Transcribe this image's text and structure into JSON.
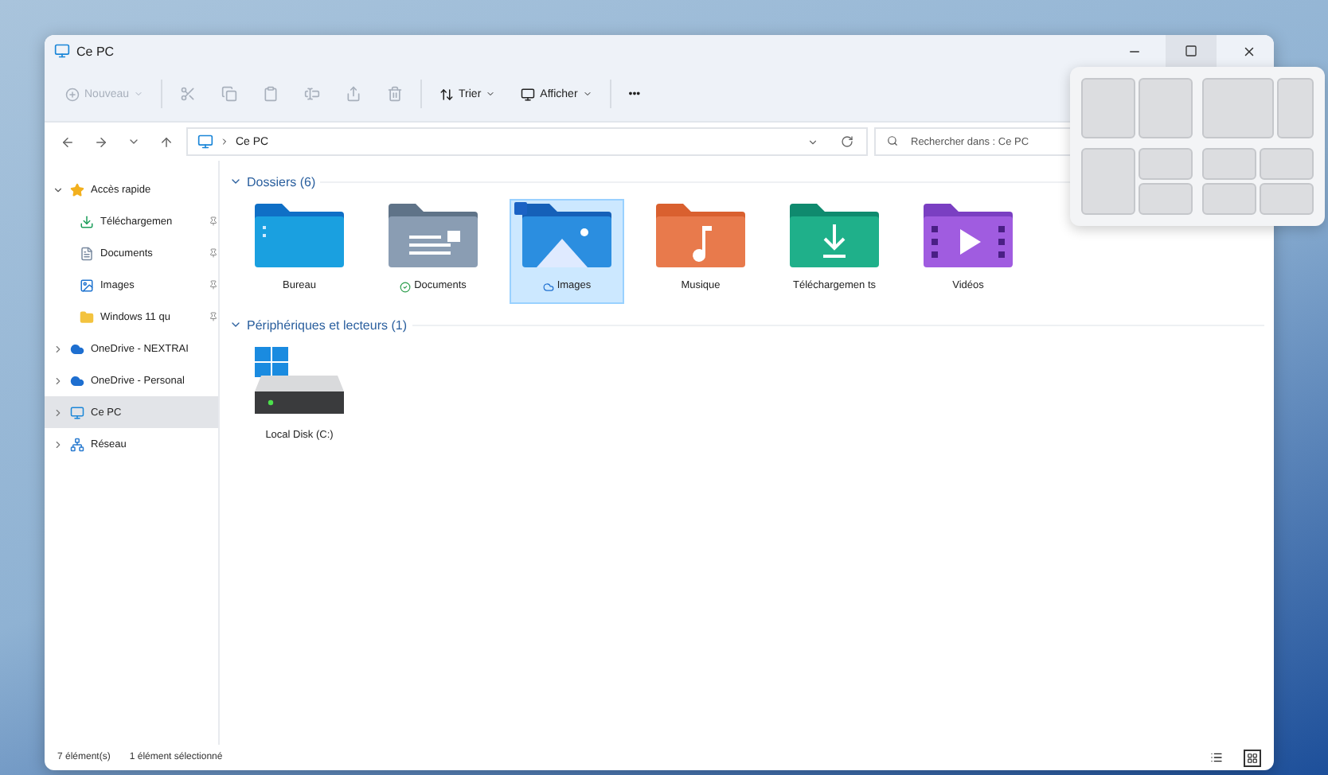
{
  "window": {
    "title": "Ce PC"
  },
  "toolbar": [
    {
      "kind": "menu",
      "label": "Nouveau",
      "disabled": true
    },
    {
      "kind": "separator"
    },
    {
      "kind": "icon",
      "disabled": true
    },
    {
      "kind": "icon",
      "disabled": true
    },
    {
      "kind": "icon",
      "disabled": true
    },
    {
      "kind": "icon",
      "disabled": true
    },
    {
      "kind": "icon",
      "disabled": true
    },
    {
      "kind": "icon",
      "disabled": true
    },
    {
      "kind": "separator"
    },
    {
      "kind": "menu",
      "label": "Trier",
      "disabled": false
    },
    {
      "kind": "menu",
      "label": "Afficher",
      "disabled": false
    },
    {
      "kind": "separator"
    },
    {
      "kind": "more",
      "label": "•••",
      "disabled": false
    }
  ],
  "address": {
    "path": [
      "Ce PC"
    ],
    "search_placeholder": "Rechercher dans : Ce PC"
  },
  "sidebar": [
    {
      "label": "Accès rapide",
      "expanded": true,
      "selected": false,
      "children": [
        {
          "label": "Téléchargemen",
          "pinned": true,
          "selected": false
        },
        {
          "label": "Documents",
          "pinned": true,
          "selected": false
        },
        {
          "label": "Images",
          "pinned": true,
          "selected": false
        },
        {
          "label": "Windows 11 qu",
          "pinned": true,
          "selected": false
        }
      ]
    },
    {
      "label": "OneDrive - NEXTRAI",
      "expanded": false,
      "selected": false
    },
    {
      "label": "OneDrive - Personal",
      "expanded": false,
      "selected": false
    },
    {
      "label": "Ce PC",
      "expanded": false,
      "selected": true
    },
    {
      "label": "Réseau",
      "expanded": false,
      "selected": false
    }
  ],
  "sections": [
    {
      "title": "Dossiers (6)",
      "expanded": true,
      "items": [
        {
          "name": "Bureau",
          "selected": false
        },
        {
          "name": "Documents",
          "selected": false
        },
        {
          "name": "Images",
          "selected": true
        },
        {
          "name": "Musique",
          "selected": false
        },
        {
          "name": "Téléchargemen ts",
          "selected": false
        },
        {
          "name": "Vidéos",
          "selected": false
        }
      ]
    },
    {
      "title": "Périphériques et lecteurs (1)",
      "expanded": true,
      "items": [
        {
          "name": "Local Disk (C:)",
          "selected": false
        }
      ]
    }
  ],
  "status_bar": {
    "count": "7 élément(s)",
    "selection": "1 élément sélectionné",
    "views": [
      {
        "kind": "details",
        "selected": false
      },
      {
        "kind": "tiles",
        "selected": true
      }
    ]
  }
}
